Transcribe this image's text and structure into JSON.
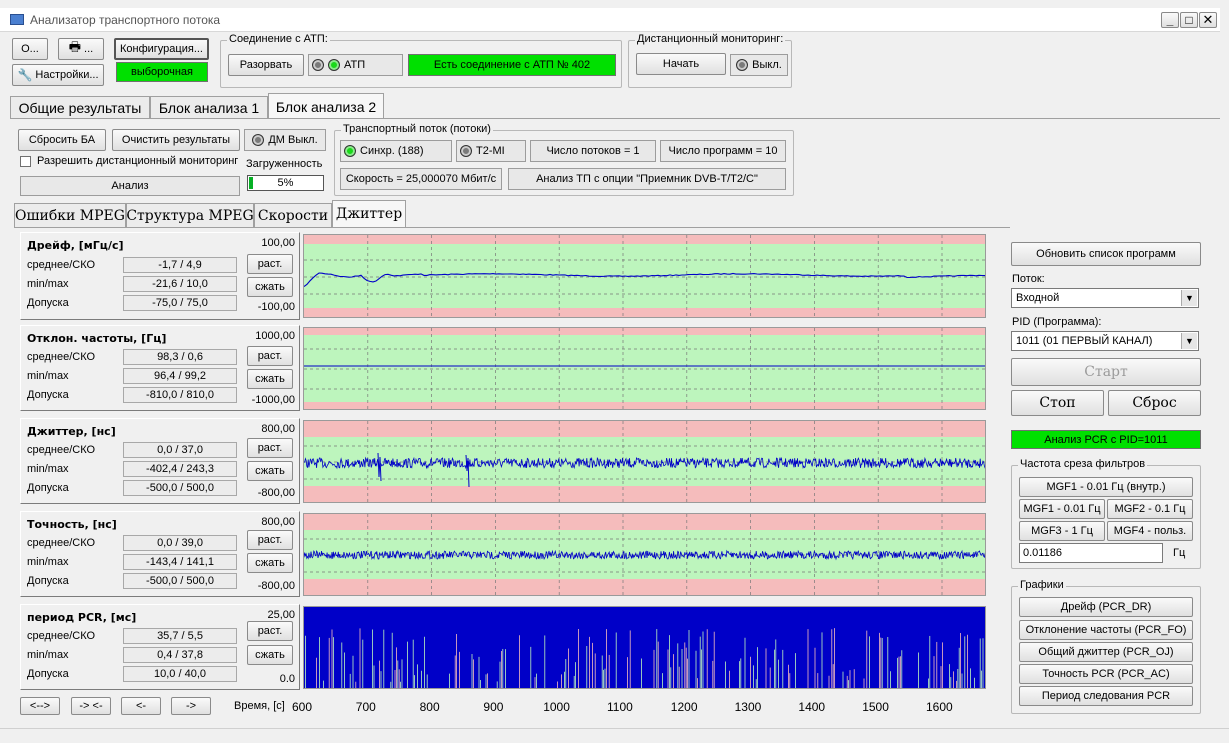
{
  "window": {
    "title": "Анализатор транспортного потока"
  },
  "toolbar": {
    "open": "О...",
    "print": "...",
    "settings": "Настройки...",
    "config": "Конфигурация...",
    "config_mode": "выборочная"
  },
  "atp": {
    "group": "Соединение с АТП:",
    "disconnect": "Разорвать",
    "led": "АТП",
    "status": "Есть соединение с АТП № 402"
  },
  "remote": {
    "group": "Дистанционный мониторинг:",
    "start": "Начать",
    "state": "Выкл."
  },
  "main_tabs": [
    "Общие результаты",
    "Блок анализа 1",
    "Блок анализа 2"
  ],
  "block": {
    "reset_ba": "Сбросить БА",
    "clear": "Очистить результаты",
    "dm": "ДМ Выкл.",
    "allow_remote": "Разрешить дистанционный мониторинг",
    "analysis": "Анализ",
    "load_label": "Загруженность",
    "load_value": "5%",
    "load_fraction": 0.05
  },
  "ts": {
    "group": "Транспортный поток (потоки)",
    "sync": "Синхр. (188)",
    "t2mi": "T2-MI",
    "streams": "Число потоков = 1",
    "programs": "Число программ = 10",
    "speed": "Скорость = 25,000070 Мбит/с",
    "option": "Анализ ТП с опции \"Приемник DVB-T/T2/C\""
  },
  "sub_tabs": [
    "Ошибки MPEG",
    "Структура MPEG",
    "Скорости",
    "Джиттер"
  ],
  "labels": {
    "mean": "среднее/СКО",
    "minmax": "min/max",
    "tol": "Допуска",
    "expand": "раст.",
    "shrink": "сжать"
  },
  "panels": [
    {
      "title": "Дрейф, [мГц/с]",
      "mean": "-1,7 / 4,9",
      "minmax": "-21,6 / 10,0",
      "tol": "-75,0 / 75,0",
      "top": "100,00",
      "bot": "-100,00"
    },
    {
      "title": "Отклон. частоты, [Гц]",
      "mean": "98,3 / 0,6",
      "minmax": "96,4 / 99,2",
      "tol": "-810,0 / 810,0",
      "top": "1000,00",
      "bot": "-1000,00"
    },
    {
      "title": "Джиттер, [нс]",
      "mean": "0,0 / 37,0",
      "minmax": "-402,4 / 243,3",
      "tol": "-500,0 / 500,0",
      "top": "800,00",
      "bot": "-800,00"
    },
    {
      "title": "Точность, [нс]",
      "mean": "0,0 / 39,0",
      "minmax": "-143,4 / 141,1",
      "tol": "-500,0 / 500,0",
      "top": "800,00",
      "bot": "-800,00"
    },
    {
      "title": "период PCR, [мс]",
      "mean": "35,7 / 5,5",
      "minmax": "0,4 / 37,8",
      "tol": "10,0 / 40,0",
      "top": "25,00",
      "bot": "0.0"
    }
  ],
  "nav": {
    "b1": "<-->",
    "b2": "-> <-",
    "b3": "<-",
    "b4": "->",
    "time_label": "Время, [с]"
  },
  "x_ticks": [
    "600",
    "700",
    "800",
    "900",
    "1000",
    "1100",
    "1200",
    "1300",
    "1400",
    "1500",
    "1600"
  ],
  "right": {
    "refresh": "Обновить список программ",
    "stream_label": "Поток:",
    "stream_value": "Входной",
    "pid_label": "PID (Программа):",
    "pid_value": "1011 (01 ПЕРВЫЙ КАНАЛ)",
    "start": "Старт",
    "stop": "Стоп",
    "reset": "Сброс",
    "pcr_status": "Анализ PCR с PID=1011",
    "filter_group": "Частота среза фильтров",
    "mgf1_int": "MGF1 - 0.01 Гц (внутр.)",
    "mgf1": "MGF1 - 0.01 Гц",
    "mgf2": "MGF2 - 0.1 Гц",
    "mgf3": "MGF3 - 1 Гц",
    "mgf4": "MGF4 - польз.",
    "freq_value": "0.01186",
    "freq_unit": "Гц",
    "graphs_group": "Графики",
    "g1": "Дрейф (PCR_DR)",
    "g2": "Отклонение частоты (PCR_FO)",
    "g3": "Общий джиттер (PCR_OJ)",
    "g4": "Точность PCR (PCR_AC)",
    "g5": "Период следования PCR"
  },
  "colors": {
    "plot_green": "#bdf5bd",
    "plot_red": "#f5bcbc",
    "trace": "#0000c8",
    "status_green": "#00e000"
  }
}
